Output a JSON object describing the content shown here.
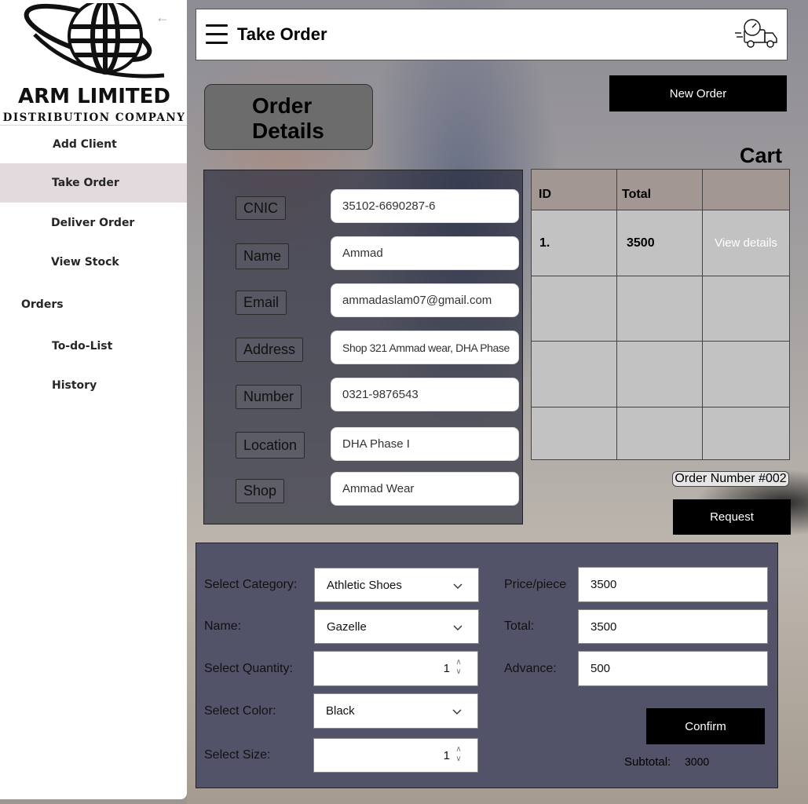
{
  "sidebar": {
    "logo": {
      "line1": "ARM LIMITED",
      "line2": "DISTRIBUTION COMPANY"
    },
    "items": [
      {
        "label": "Add Client"
      },
      {
        "label": "Take Order"
      },
      {
        "label": "Deliver Order"
      },
      {
        "label": "View Stock"
      },
      {
        "label": "Orders"
      },
      {
        "label": "To-do-List"
      },
      {
        "label": "History"
      }
    ],
    "active_item": "Take Order"
  },
  "header": {
    "title": "Take Order",
    "icon": "delivery-truck-icon"
  },
  "buttons": {
    "new_order": "New Order",
    "request": "Request",
    "confirm": "Confirm"
  },
  "order_details": {
    "title_line1": "Order",
    "title_line2": "Details"
  },
  "client": {
    "labels": {
      "cnic": "CNIC",
      "name": "Name",
      "email": "Email",
      "address": "Address",
      "number": "Number",
      "location": "Location",
      "shop": "Shop"
    },
    "values": {
      "cnic": "35102-6690287-6",
      "name": "Ammad",
      "email": "ammadaslam07@gmail.com",
      "address": "Shop 321 Ammad wear, DHA Phase",
      "number": "0321-9876543",
      "location": "DHA Phase I",
      "shop": "Ammad Wear"
    }
  },
  "cart": {
    "title": "Cart",
    "columns": [
      "ID",
      "Total",
      ""
    ],
    "rows": [
      {
        "id": "1.",
        "total": "3500",
        "action": "View details"
      }
    ]
  },
  "order_number": "Order Number #002",
  "product": {
    "labels": {
      "category": "Select Category:",
      "name": "Name:",
      "quantity": "Select Quantity:",
      "color": "Select Color:",
      "size": "Select Size:",
      "price": "Price/piece",
      "total": "Total:",
      "advance": "Advance:",
      "subtotal": "Subtotal:"
    },
    "values": {
      "category": "Athletic Shoes",
      "name": "Gazelle",
      "quantity": "1",
      "color": "Black",
      "size": "1",
      "price": "3500",
      "total": "3500",
      "advance": "500",
      "subtotal": "3000"
    }
  }
}
